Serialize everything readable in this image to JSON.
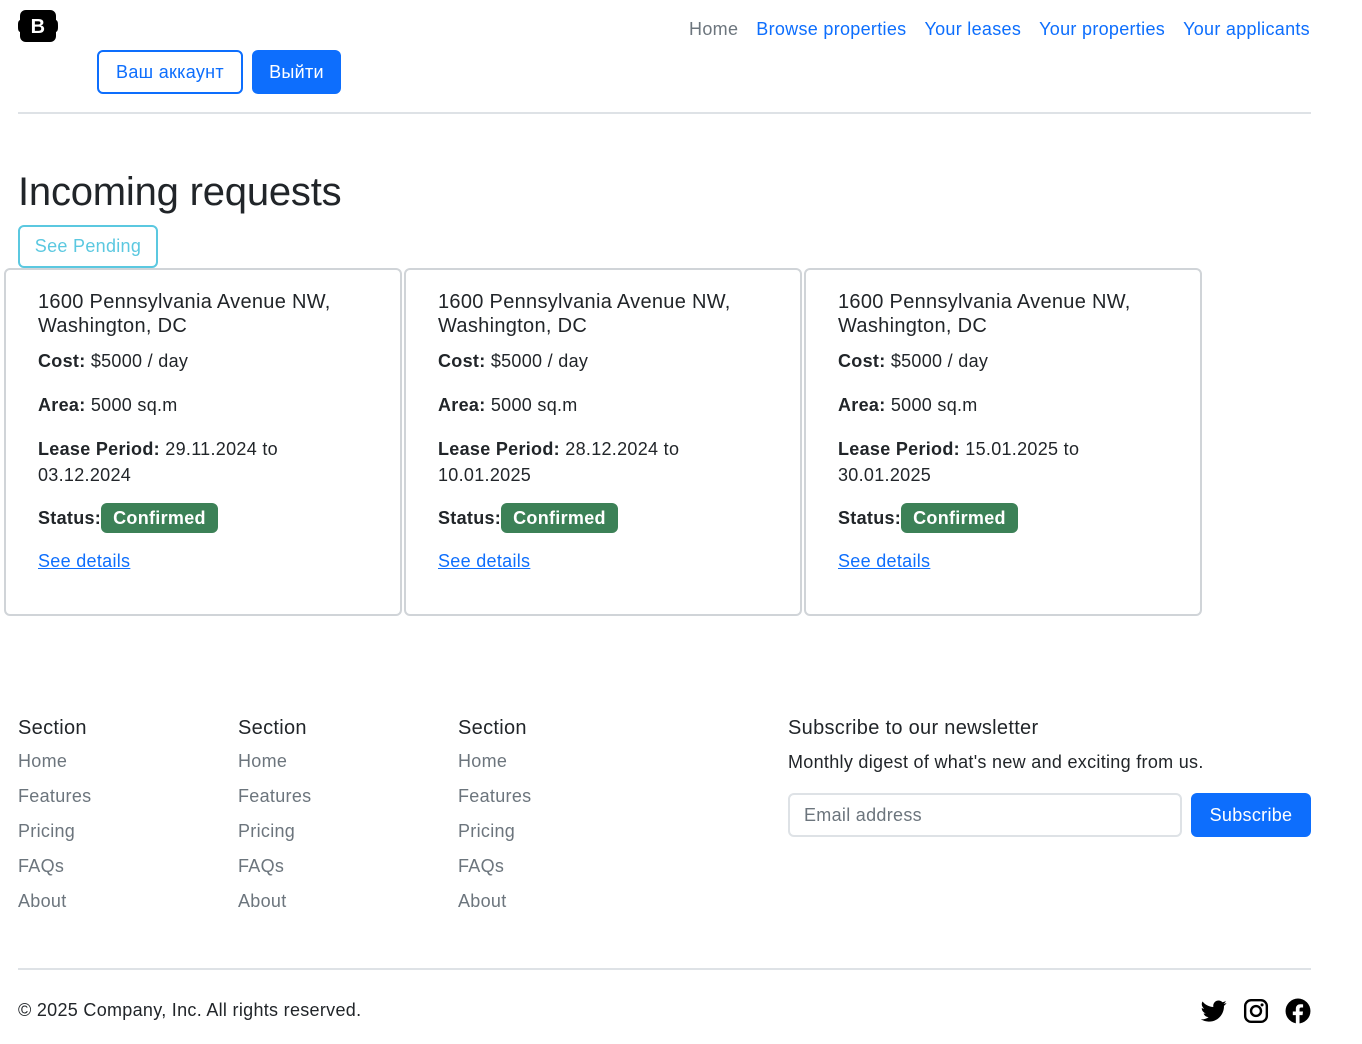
{
  "header": {
    "nav": [
      "Home",
      "Browse properties",
      "Your leases",
      "Your properties",
      "Your applicants"
    ],
    "account_button": "Ваш аккаунт",
    "logout_button": "Выйти"
  },
  "main": {
    "title": "Incoming requests",
    "filter_button": "See Pending",
    "cards": [
      {
        "address": "1600 Pennsylvania Avenue NW, Washington, DC",
        "cost_label": "Cost:",
        "cost_value": "$5000 / day",
        "area_label": "Area:",
        "area_value": "5000 sq.m",
        "period_label": "Lease Period:",
        "period_value": "29.11.2024 to 03.12.2024",
        "status_label": "Status:",
        "status_value": "Confirmed",
        "link": "See details"
      },
      {
        "address": "1600 Pennsylvania Avenue NW, Washington, DC",
        "cost_label": "Cost:",
        "cost_value": "$5000 / day",
        "area_label": "Area:",
        "area_value": "5000 sq.m",
        "period_label": "Lease Period:",
        "period_value": "28.12.2024 to 10.01.2025",
        "status_label": "Status:",
        "status_value": "Confirmed",
        "link": "See details"
      },
      {
        "address": "1600 Pennsylvania Avenue NW, Washington, DC",
        "cost_label": "Cost:",
        "cost_value": "$5000 / day",
        "area_label": "Area:",
        "area_value": "5000 sq.m",
        "period_label": "Lease Period:",
        "period_value": "15.01.2025 to 30.01.2025",
        "status_label": "Status:",
        "status_value": "Confirmed",
        "link": "See details"
      }
    ]
  },
  "footer": {
    "columns": [
      {
        "title": "Section",
        "links": [
          "Home",
          "Features",
          "Pricing",
          "FAQs",
          "About"
        ]
      },
      {
        "title": "Section",
        "links": [
          "Home",
          "Features",
          "Pricing",
          "FAQs",
          "About"
        ]
      },
      {
        "title": "Section",
        "links": [
          "Home",
          "Features",
          "Pricing",
          "FAQs",
          "About"
        ]
      }
    ],
    "newsletter": {
      "title": "Subscribe to our newsletter",
      "text": "Monthly digest of what's new and exciting from us.",
      "placeholder": "Email address",
      "button": "Subscribe"
    },
    "copyright": "© 2025 Company, Inc. All rights reserved.",
    "socials": [
      "twitter-icon",
      "instagram-icon",
      "facebook-icon"
    ]
  },
  "colors": {
    "primary": "#0d6efd",
    "info": "#5bc8e0",
    "success": "#3c8157",
    "muted": "#6c757d"
  }
}
